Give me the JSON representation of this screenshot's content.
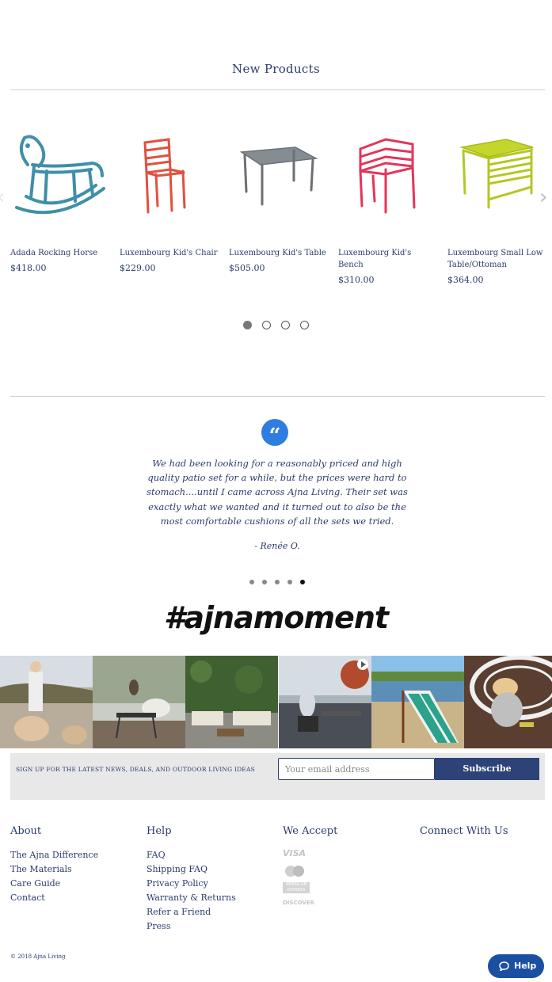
{
  "new_products": {
    "title": "New Products",
    "items": [
      {
        "name": "Adada Rocking Horse",
        "price": "$418.00",
        "color": "#3f8fa8"
      },
      {
        "name": "Luxembourg Kid's Chair",
        "price": "$229.00",
        "color": "#e0513f"
      },
      {
        "name": "Luxembourg Kid's Table",
        "price": "$505.00",
        "color": "#7a8288"
      },
      {
        "name": "Luxembourg Kid's Bench",
        "price": "$310.00",
        "color": "#e3355a"
      },
      {
        "name": "Luxembourg Small Low Table/Ottoman",
        "price": "$364.00",
        "color": "#c4d62b"
      }
    ],
    "page_dots": 4,
    "active_dot": 0
  },
  "testimonial": {
    "quote": "We had been looking for a reasonably priced and high quality patio set for a while, but the prices were hard to stomach....until I came across Ajna Living. Their set was exactly what we wanted and it turned out to also be the most comfortable cushions of all the sets we tried.",
    "author": "- Renée O.",
    "dots": 5,
    "active_dot": 4,
    "badge_color": "#2f7de1"
  },
  "hashtag": "#ajnamoment",
  "signup": {
    "label": "Sign up for the latest news, deals, and outdoor living ideas",
    "placeholder": "Your email address",
    "button": "Subscribe"
  },
  "footer": {
    "about": {
      "title": "About",
      "links": [
        "The Ajna Difference",
        "The Materials",
        "Care Guide",
        "Contact"
      ]
    },
    "help": {
      "title": "Help",
      "links": [
        "FAQ",
        "Shipping FAQ",
        "Privacy Policy",
        "Warranty & Returns",
        "Refer a Friend",
        "Press"
      ]
    },
    "accept": {
      "title": "We Accept",
      "cards": [
        "VISA",
        "MasterCard",
        "AMERICAN EXPRESS",
        "DISCOVER"
      ]
    },
    "connect": {
      "title": "Connect With Us"
    },
    "copyright": "© 2018 Ajna Living"
  },
  "help_button": {
    "label": "Help",
    "color": "#1b4fa0"
  }
}
